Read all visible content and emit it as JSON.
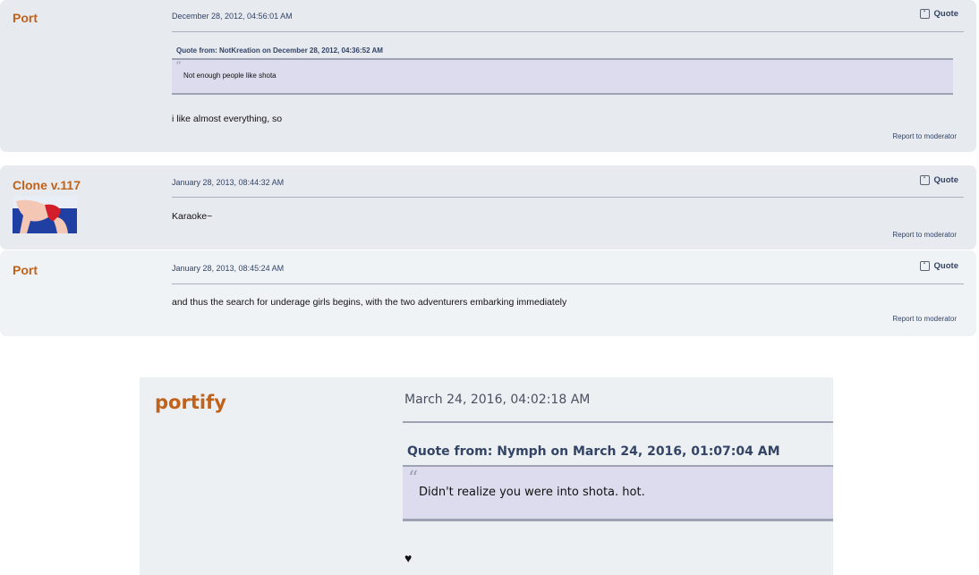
{
  "posts": [
    {
      "poster": "Port",
      "date": "December 28, 2012, 04:56:01 AM",
      "quote_label": "Quote",
      "quote_header": "Quote from: NotKreation on December 28, 2012, 04:36:52 AM",
      "quote_text": "Not enough people like shota",
      "body": "i like almost everything, so",
      "report": "Report to moderator"
    },
    {
      "poster": "Clone v.117",
      "date": "January 28, 2013, 08:44:32 AM",
      "quote_label": "Quote",
      "body": "Karaoke~",
      "report": "Report to moderator"
    },
    {
      "poster": "Port",
      "date": "January 28, 2013, 08:45:24 AM",
      "quote_label": "Quote",
      "body": "and thus the search for underage girls begins, with the two adventurers embarking immediately",
      "report": "Report to moderator"
    }
  ],
  "zoomed_post": {
    "poster": "portify",
    "date": "March 24, 2016, 04:02:18 AM",
    "quote_header": "Quote from: Nymph on March 24, 2016, 01:07:04 AM",
    "quote_text": "Didn't realize you were into shota. hot.",
    "body": "♥"
  },
  "colors": {
    "poster_name": "#c0621a",
    "post_bg_dark": "#e7eaef",
    "post_bg_light": "#f0f3f6",
    "quote_bg": "#dcdcee"
  }
}
